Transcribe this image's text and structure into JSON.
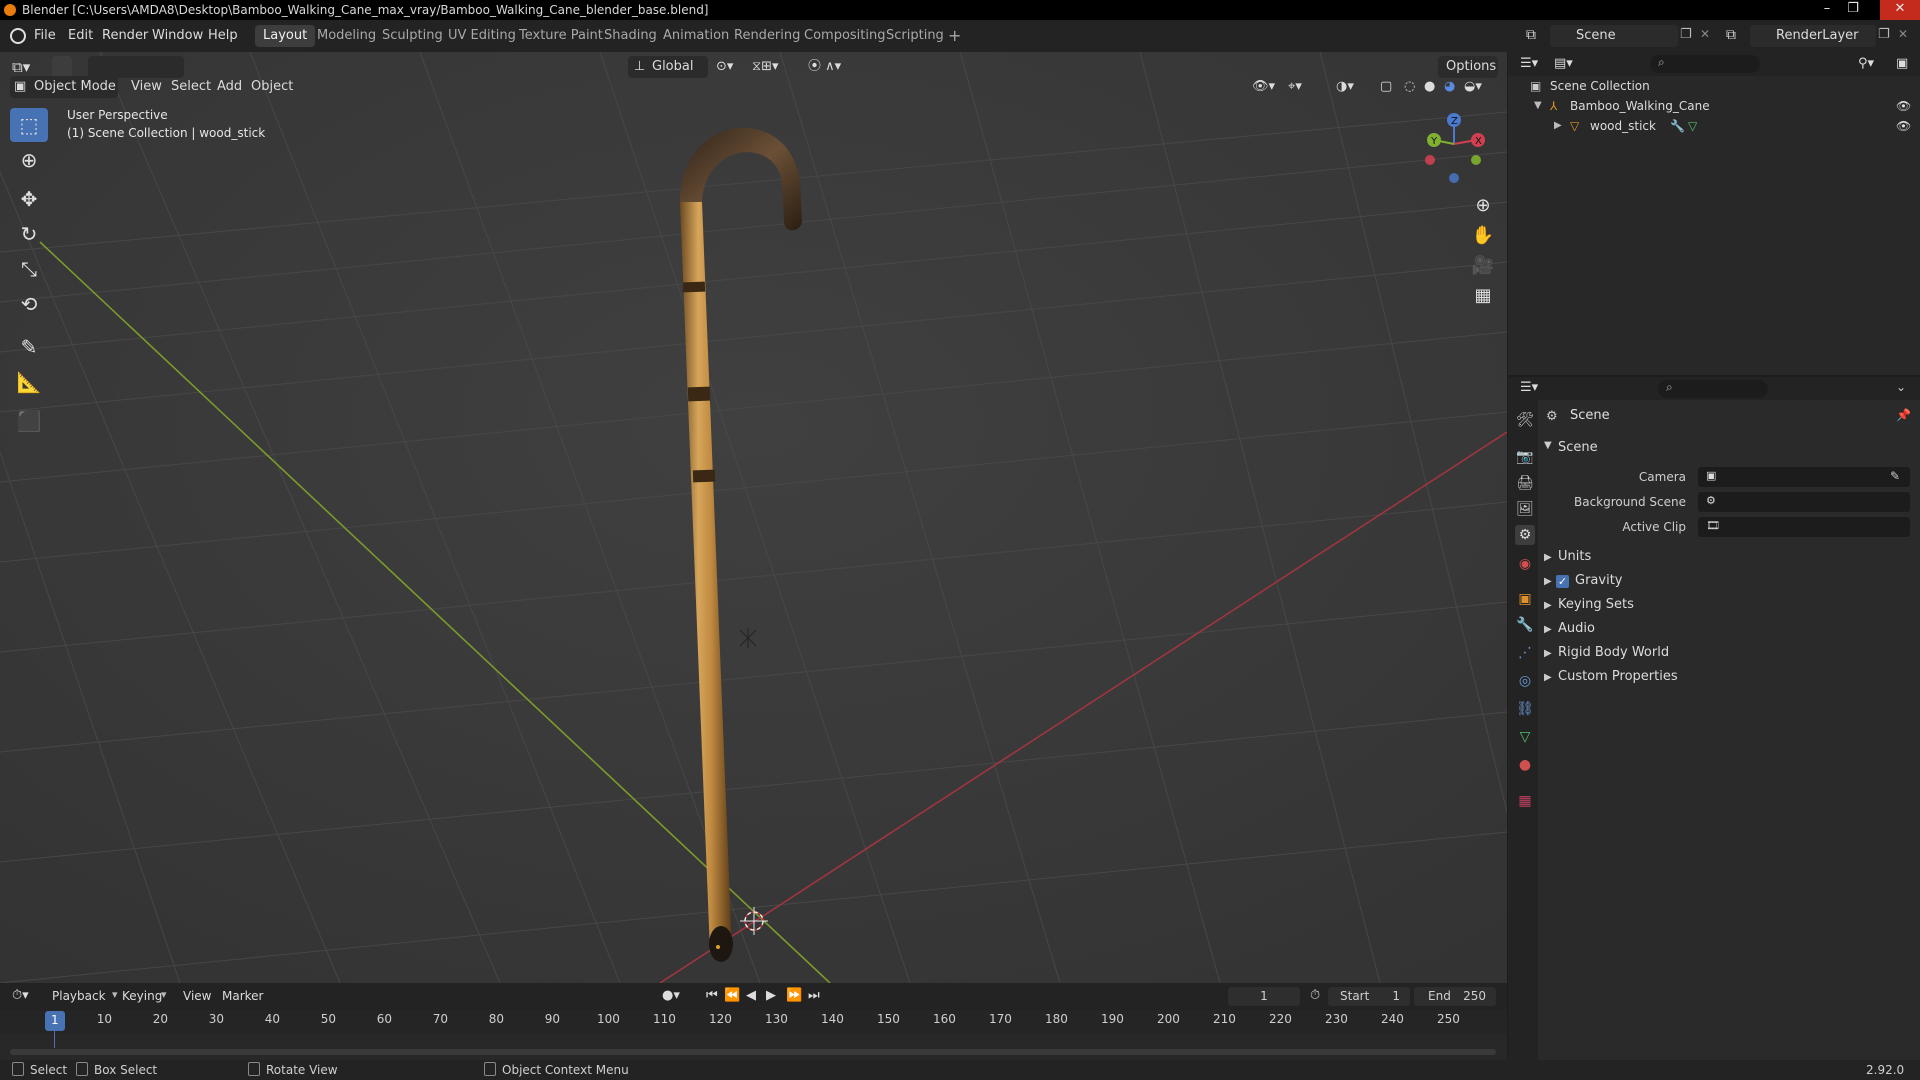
{
  "window": {
    "title": "Blender [C:\\Users\\AMDA8\\Desktop\\Bamboo_Walking_Cane_max_vray/Bamboo_Walking_Cane_blender_base.blend]",
    "minimize": "–",
    "maximize": "❐",
    "close": "✕"
  },
  "menu": [
    "File",
    "Edit",
    "Render",
    "Window",
    "Help"
  ],
  "workspaces": [
    "Layout",
    "Modeling",
    "Sculpting",
    "UV Editing",
    "Texture Paint",
    "Shading",
    "Animation",
    "Rendering",
    "Compositing",
    "Scripting"
  ],
  "workspace_add": "+",
  "active_workspace": "Layout",
  "scene_field": "Scene",
  "renderlayer_field": "RenderLayer",
  "viewport": {
    "mode": "Object Mode",
    "menus": [
      "View",
      "Select",
      "Add",
      "Object"
    ],
    "transform_orientation": "Global",
    "options": "Options",
    "overlay_title": "User Perspective",
    "overlay_subtitle": "(1) Scene Collection | wood_stick",
    "gizmo": {
      "x": "X",
      "y": "Y",
      "z": "Z"
    }
  },
  "outliner": {
    "root": "Scene Collection",
    "items": [
      {
        "label": "Bamboo_Walking_Cane"
      },
      {
        "label": "wood_stick"
      }
    ]
  },
  "properties": {
    "header": "Scene",
    "section": "Scene",
    "fields": [
      {
        "label": "Camera"
      },
      {
        "label": "Background Scene"
      },
      {
        "label": "Active Clip"
      }
    ],
    "subsections": [
      "Units",
      "Gravity",
      "Keying Sets",
      "Audio",
      "Rigid Body World",
      "Custom Properties"
    ],
    "gravity_checked": true
  },
  "timeline": {
    "menus": [
      "Playback",
      "Keying",
      "View",
      "Marker"
    ],
    "current_frame": "1",
    "start_label": "Start",
    "start": "1",
    "end_label": "End",
    "end": "250",
    "ticks": [
      "1",
      "10",
      "20",
      "30",
      "40",
      "50",
      "60",
      "70",
      "80",
      "90",
      "100",
      "110",
      "120",
      "130",
      "140",
      "150",
      "160",
      "170",
      "180",
      "190",
      "200",
      "210",
      "220",
      "230",
      "240",
      "250"
    ]
  },
  "statusbar": {
    "select": "Select",
    "box_select": "Box Select",
    "rotate_view": "Rotate View",
    "context_menu": "Object Context Menu",
    "version": "2.92.0"
  }
}
